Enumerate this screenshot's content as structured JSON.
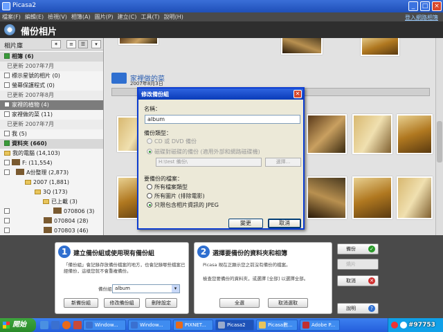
{
  "window": {
    "title": "Picasa2"
  },
  "menu": {
    "items": [
      "檔案(F)",
      "編輯(E)",
      "檢視(V)",
      "相簿(A)",
      "圖片(P)",
      "建立(C)",
      "工具(T)",
      "說明(H)"
    ],
    "sign_in": "登入網路相簿"
  },
  "header": {
    "title": "備份相片"
  },
  "sidebar": {
    "library_label": "相片庫",
    "rows": [
      {
        "text": "相簿 (6)",
        "kind": "section"
      },
      {
        "text": "已更新 2007年7月",
        "kind": "date"
      },
      {
        "text": "標示星號的相片 (0)",
        "kind": "item"
      },
      {
        "text": "螢幕保護程式 (0)",
        "kind": "item"
      },
      {
        "text": "已更新 2007年8月",
        "kind": "date"
      },
      {
        "text": "家裡的植物 (4)",
        "kind": "selected"
      },
      {
        "text": "家裡做的菜 (11)",
        "kind": "item"
      },
      {
        "text": "已更新 2007年7月",
        "kind": "date"
      },
      {
        "text": "我 (5)",
        "kind": "item"
      },
      {
        "text": "資料夾 (660)",
        "kind": "section"
      },
      {
        "text": "我的電腦 (14,103)",
        "kind": "folder"
      },
      {
        "text": "F: (11,554)",
        "kind": "folder"
      },
      {
        "text": "A份整理 (2,873)",
        "kind": "folder"
      },
      {
        "text": "2007 (1,881)",
        "kind": "folder"
      },
      {
        "text": "3Q (173)",
        "kind": "folder"
      },
      {
        "text": "已上載 (3)",
        "kind": "folder"
      },
      {
        "text": "070806 (3)",
        "kind": "folder"
      },
      {
        "text": "070804 (28)",
        "kind": "folder"
      },
      {
        "text": "070803 (46)",
        "kind": "folder"
      }
    ]
  },
  "album": {
    "title": "家裡做的菜",
    "date": "2007年8月3日"
  },
  "dialog": {
    "title": "修改備份組",
    "name_label": "名稱：",
    "name_value": "album",
    "type_label": "備份類型：",
    "type_options": [
      "CD 或 DVD 備份",
      "磁碟對磁碟的備份 (適用外部和網路磁碟機)"
    ],
    "path_value": "H:\\test 備份\\",
    "browse": "選擇...",
    "files_label": "要備份的檔案：",
    "file_options": [
      "所有檔案類型",
      "所有圖片 (排除電影)",
      "只限包含相片資訊的 JPEG"
    ],
    "file_selected": 2,
    "ok": "變更",
    "cancel": "取消"
  },
  "panel1": {
    "step": "1",
    "title": "建立備份組或使用現有備份組",
    "desc": "「備份組」會記錄存放備份檔案的地方，也會記錄哪些檔案已經備份，這樣您就不會重複備份。",
    "set_label": "備份組",
    "set_value": "album",
    "buttons": [
      "新備份組",
      "修改備份組",
      "刪除設定"
    ]
  },
  "panel2": {
    "step": "2",
    "title": "選擇要備份的資料夾和相簿",
    "desc1": "Picasa 現在正顯示您之前沒有備份的檔案。",
    "desc2": "檢查您要備份的資料夾，或選擇 [全部] 以選擇全部。",
    "buttons": [
      "全選",
      "取消選取"
    ]
  },
  "side_buttons": [
    {
      "label": "備份",
      "icon": "check-icon",
      "disabled": false
    },
    {
      "label": "燒片",
      "icon": "",
      "disabled": true
    },
    {
      "label": "取消",
      "icon": "x-icon",
      "disabled": false
    },
    {
      "label": "說明",
      "icon": "help-icon",
      "disabled": false
    }
  ],
  "taskbar": {
    "start": "開始",
    "tasks": [
      "Window...",
      "Window...",
      "PIXNET...",
      "Picasa2",
      "Picasa數...",
      "Adobe P..."
    ],
    "watermark": "#97753"
  },
  "colors": {
    "accent": "#2f6fd0",
    "titlebar": "#245edb",
    "dialog_border": "#0a3bd0"
  }
}
